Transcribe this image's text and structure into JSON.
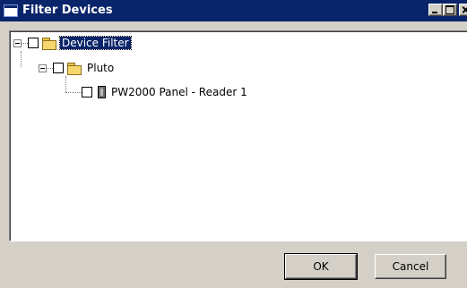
{
  "window": {
    "title": "Filter Devices",
    "title_icon": "window-icon"
  },
  "tree": {
    "root": {
      "label": "Device Filter",
      "icon": "folder-icon",
      "expanded": true,
      "checked": false,
      "selected": true
    },
    "child": {
      "label": "Pluto",
      "icon": "folder-icon",
      "expanded": true,
      "checked": false
    },
    "leaf": {
      "label": "PW2000 Panel - Reader 1",
      "icon": "reader-icon",
      "checked": false
    }
  },
  "buttons": {
    "ok_label": "OK",
    "cancel_label": "Cancel"
  },
  "colors": {
    "title_bar": "#0a246a",
    "face": "#d4d0c8",
    "selection": "#0a246a"
  }
}
